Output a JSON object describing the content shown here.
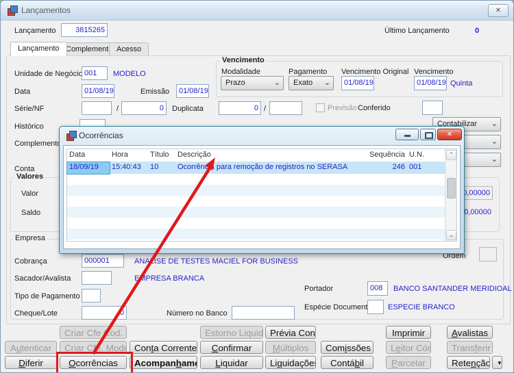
{
  "window": {
    "title": "Lançamentos",
    "close_glyph": "✕"
  },
  "header": {
    "lancamento_label": "Lançamento",
    "lancamento_value": "3815265",
    "ultimo_label": "Último Lançamento",
    "ultimo_value": "0"
  },
  "tabs": {
    "t1": "Lançamento",
    "t2": "Complemento",
    "t3": "Acesso"
  },
  "form": {
    "slash": "/",
    "unidade_label": "Unidade de Negócio",
    "unidade_code": "001",
    "unidade_desc": "MODELO",
    "data_label": "Data",
    "data_value": "01/08/19",
    "emissao_label": "Emissão",
    "emissao_value": "01/08/19",
    "serie_label": "Série/NF",
    "serie_num": "0",
    "duplicata_label": "Duplicata",
    "duplicata_value": "0",
    "previsao_label": "Previsão",
    "conferido_label": "Conferido",
    "historico_label": "Histórico",
    "complemento_label": "Complemento",
    "conta_label": "Conta"
  },
  "vencimento": {
    "title": "Vencimento",
    "modalidade_label": "Modalidade",
    "modalidade_value": "Prazo",
    "pagamento_label": "Pagamento",
    "pagamento_value": "Exato",
    "venc_orig_label": "Vencimento Original",
    "venc_orig_value": "01/08/19",
    "venc_label": "Vencimento",
    "venc_value": "01/08/19",
    "venc_weekday": "Quinta"
  },
  "right_combos": {
    "combo1_value": "Contabilizar"
  },
  "valores": {
    "title": "Valores",
    "valor_label": "Valor",
    "valor_value": "0,00000",
    "saldo_label": "Saldo",
    "saldo_value": "0,00000"
  },
  "empresa": {
    "title": "Empresa",
    "cobranca_label": "Cobrança",
    "cobranca_code": "000001",
    "cobranca_desc": "ANALISE DE TESTES MACIEL FOR BUSINESS",
    "sacador_label": "Sacador/Avalista",
    "sacador_desc": "EMPRESA BRANCA",
    "tipo_pag_label": "Tipo de Pagamento",
    "cheque_label": "Cheque/Lote",
    "cheque_value": "0",
    "numero_banco_label": "Número no Banco",
    "portador_label": "Portador",
    "portador_code": "008",
    "portador_desc": "BANCO SANTANDER MERIDIOAL",
    "especie_label": "Espécie Documento",
    "especie_desc": "ESPECIE BRANCO",
    "ordem_label": "Ordem"
  },
  "dialog": {
    "title": "Ocorrências",
    "columns": {
      "data": "Data",
      "hora": "Hora",
      "titulo": "Título",
      "descricao": "Descrição",
      "sequencia": "Sequência",
      "un": "U.N."
    },
    "row": {
      "data": "18/09/19",
      "hora": "15:40:43",
      "titulo": "10",
      "descricao": "Ocorrência para remoção de registros no SERASA",
      "sequencia": "246",
      "un": "001"
    }
  },
  "buttons": {
    "criar_cfe_cod_barras": {
      "label": "Criar Cfe Cod. Barras",
      "m": -1,
      "enabled": false
    },
    "estorno_liquidacao": {
      "label": "Estorno Liquidação",
      "m": -1,
      "enabled": false
    },
    "previa_contabil": {
      "label": "Prévia Contábil",
      "m": -1,
      "enabled": true
    },
    "imprimir": {
      "label": "Imprimir",
      "m": -1,
      "enabled": true
    },
    "avalistas": {
      "label": "Avalistas",
      "m": 0,
      "enabled": true
    },
    "autenticar": {
      "label": "Autenticar",
      "m": 1,
      "enabled": false
    },
    "criar_cfe_modelo": {
      "label": "Criar Cfe. Modelo",
      "m": 4,
      "enabled": false
    },
    "conta_corrente": {
      "label": "Conta Corrente",
      "m": 3,
      "enabled": true
    },
    "confirmar": {
      "label": "Confirmar",
      "m": 0,
      "enabled": true
    },
    "multiplos": {
      "label": "Múltiplos",
      "m": 0,
      "enabled": false
    },
    "comissoes": {
      "label": "Comissões",
      "m": 3,
      "enabled": true
    },
    "leitor_cod_barras": {
      "label": "Leitor Cód. Barras",
      "m": 1,
      "enabled": false
    },
    "transferir": {
      "label": "Transferir",
      "m": 5,
      "enabled": false
    },
    "diferir": {
      "label": "Diferir",
      "m": 0,
      "enabled": true
    },
    "ocorrencias": {
      "label": "Ocorrências",
      "m": 0,
      "enabled": true
    },
    "acompanhamento": {
      "label": "Acompanhamento",
      "m": 7,
      "enabled": true
    },
    "liquidar": {
      "label": "Liquidar",
      "m": 0,
      "enabled": true
    },
    "liquidacoes": {
      "label": "Liquidações",
      "m": 2,
      "enabled": true
    },
    "contabil": {
      "label": "Contábil",
      "m": 5,
      "enabled": true
    },
    "parcelar": {
      "label": "Parcelar",
      "m": 0,
      "enabled": false
    },
    "retencao": {
      "label": "Retenção",
      "m": 4,
      "enabled": true
    },
    "more_arrow": {
      "label": "▼",
      "m": -1,
      "enabled": true
    }
  },
  "colors": {
    "annotation_red": "#e0191c",
    "value_blue": "#2722cb",
    "dialog_border_teal": "#2f7e97"
  }
}
